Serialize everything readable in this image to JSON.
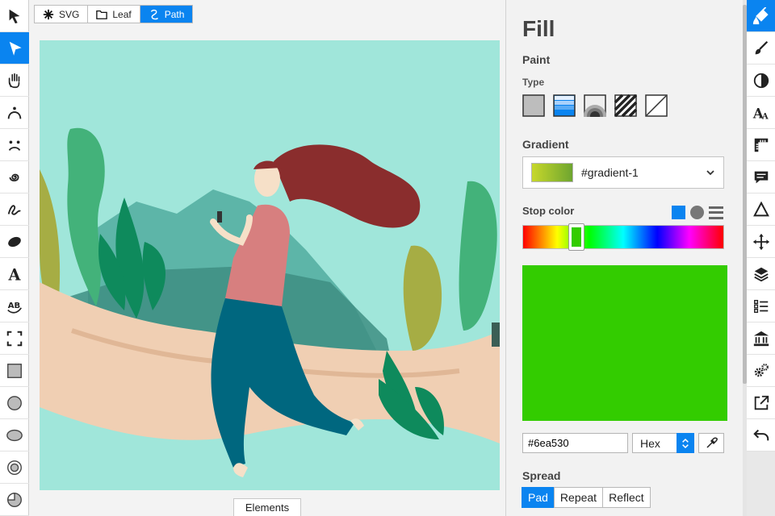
{
  "breadcrumbs": [
    {
      "label": "SVG",
      "icon": "asterisk-icon"
    },
    {
      "label": "Leaf",
      "icon": "folder-icon"
    },
    {
      "label": "Path",
      "icon": "path-icon"
    }
  ],
  "left_tools": [
    "select-arrow-icon",
    "node-arrow-icon",
    "hand-icon",
    "face-icon",
    "face-frown-icon",
    "spiral-icon",
    "freehand-icon",
    "brush-blob-icon",
    "text-icon",
    "text-path-icon",
    "frame-icon",
    "rectangle-icon",
    "circle-icon",
    "ellipse-icon",
    "ring-icon",
    "pie-icon"
  ],
  "right_tools": [
    "paint-bucket-icon",
    "brush-icon",
    "contrast-icon",
    "font-size-icon",
    "ruler-icon",
    "comment-icon",
    "triangle-icon",
    "move-icon",
    "layers-icon",
    "list-icon",
    "museum-icon",
    "gears-icon",
    "export-icon",
    "undo-icon"
  ],
  "elements_tab": "Elements",
  "panel": {
    "title": "Fill",
    "paint_label": "Paint",
    "type_label": "Type",
    "paint_types": [
      "flat-color-icon",
      "linear-gradient-icon",
      "radial-gradient-icon",
      "pattern-icon",
      "none-icon"
    ],
    "gradient_label": "Gradient",
    "gradient_name": "#gradient-1",
    "stop_color_label": "Stop color",
    "hex_value": "#6ea530",
    "format_value": "Hex",
    "spread_label": "Spread",
    "spread_options": [
      "Pad",
      "Repeat",
      "Reflect"
    ],
    "spread_selected": "Pad"
  },
  "colors": {
    "accent": "#0a84f0",
    "preview": "#33cc00",
    "canvas_bg": "#a0e6da"
  }
}
